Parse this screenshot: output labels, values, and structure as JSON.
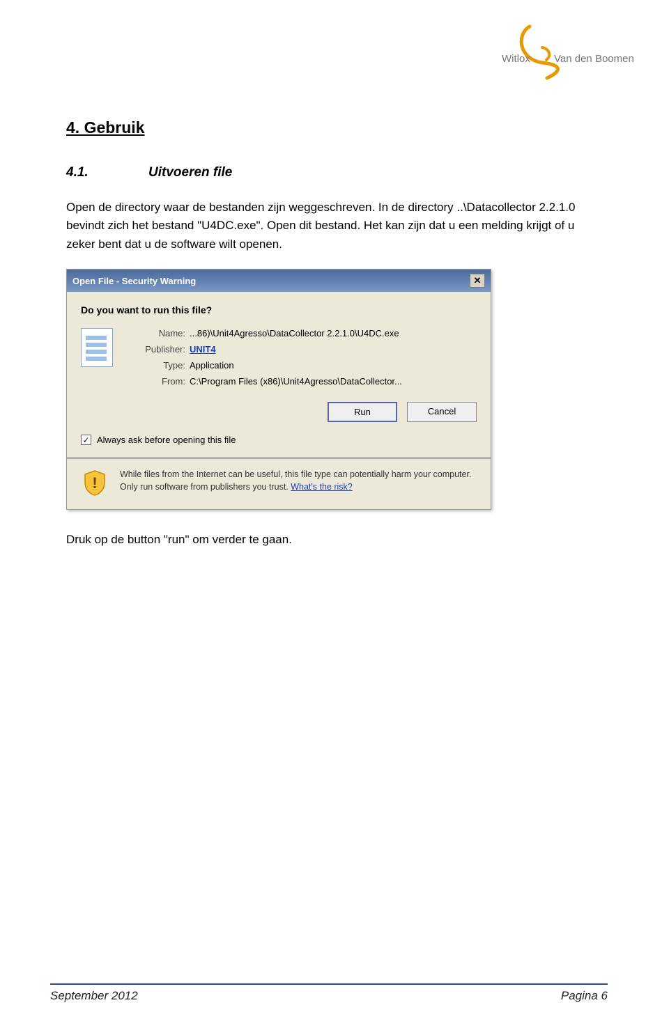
{
  "logo": {
    "left": "Witlox",
    "right": "Van den Boomen"
  },
  "heading": "4. Gebruik",
  "section": {
    "no": "4.1.",
    "title": "Uitvoeren file"
  },
  "para1": "Open de directory waar de bestanden zijn weggeschreven. In de directory ..\\Datacollector 2.2.1.0 bevindt zich het bestand \"U4DC.exe\". Open dit bestand. Het kan zijn dat u een melding krijgt of u zeker bent dat u de software wilt openen.",
  "dialog": {
    "title": "Open File - Security Warning",
    "question": "Do you want to run this file?",
    "kv": {
      "name_label": "Name:",
      "name_value": "...86)\\Unit4Agresso\\DataCollector 2.2.1.0\\U4DC.exe",
      "publisher_label": "Publisher:",
      "publisher_value": "UNIT4",
      "type_label": "Type:",
      "type_value": "Application",
      "from_label": "From:",
      "from_value": "C:\\Program Files (x86)\\Unit4Agresso\\DataCollector..."
    },
    "buttons": {
      "run": "Run",
      "cancel": "Cancel"
    },
    "checkbox_label": "Always ask before opening this file",
    "warning_text": "While files from the Internet can be useful, this file type can potentially harm your computer. Only run software from publishers you trust. ",
    "warning_link": "What's the risk?"
  },
  "para2": "Druk op de button \"run\" om verder te gaan.",
  "footer": {
    "left": "September 2012",
    "right": "Pagina 6"
  }
}
